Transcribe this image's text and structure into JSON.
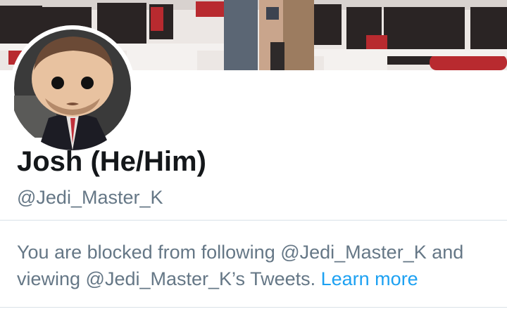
{
  "profile": {
    "display_name": "Josh (He/Him)",
    "handle": "@Jedi_Master_K",
    "banner_image": "classroom-computers-photo",
    "avatar_image": "funko-pop-figure-photo"
  },
  "blocked_notice": {
    "line1": "You are blocked from following @Jedi_Master_K and",
    "line2_prefix": "viewing @Jedi_Master_K’s Tweets.",
    "learn_more_label": "Learn more"
  },
  "colors": {
    "primary_text": "#14171a",
    "secondary_text": "#657786",
    "link": "#1da1f2",
    "divider": "#d9e1e8"
  }
}
